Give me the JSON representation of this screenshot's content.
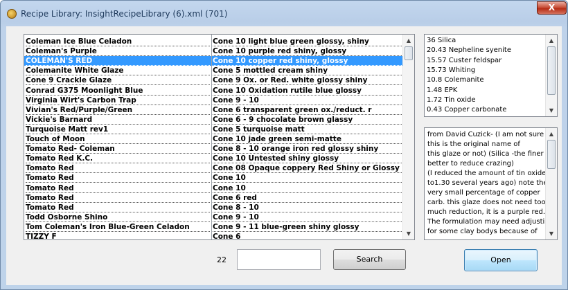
{
  "window": {
    "title": "Recipe Library: InsightRecipeLibrary (6).xml (701)",
    "close_label": "X"
  },
  "recipes": [
    {
      "name": "Coleman Ice Blue Celadon",
      "desc": "Cone 10  light blue green  glossy, shiny"
    },
    {
      "name": "Coleman's Purple",
      "desc": "Cone 10  purple red  shiny, glossy"
    },
    {
      "name": "COLEMAN'S RED",
      "desc": "Cone 10  copper red  shiny, glossy"
    },
    {
      "name": "Colemanite White Glaze",
      "desc": "Cone 5  mottled cream  shiny"
    },
    {
      "name": "Cone 9 Crackle Glaze",
      "desc": "Cone 9 Ox. or Red. white  glossy shiny"
    },
    {
      "name": "Conrad G375 Moonlight Blue",
      "desc": "Cone 10 Oxidation rutile blue  glossy"
    },
    {
      "name": "Virginia Wirt's Carbon Trap",
      "desc": "Cone 9 - 10"
    },
    {
      "name": "Vivian's Red/Purple/Green",
      "desc": "Cone 6  transparent green ox./reduct. r"
    },
    {
      "name": "Vickie's Barnard",
      "desc": "Cone 6 - 9  chocolate brown  glassy"
    },
    {
      "name": "Turquoise Matt rev1",
      "desc": "Cone 5  turquoise  matt"
    },
    {
      "name": "Touch of Moon",
      "desc": "Cone 10  jade green  semi-matte"
    },
    {
      "name": "Tomato Red- Coleman",
      "desc": "Cone 8 - 10  orange iron red  glossy shiny"
    },
    {
      "name": "Tomato Red K.C.",
      "desc": "Cone 10  Untested  shiny glossy"
    },
    {
      "name": "Tomato Red",
      "desc": "Cone 08  Opaque coppery Red  Shiny or Glossy"
    },
    {
      "name": "Tomato Red",
      "desc": "Cone 10"
    },
    {
      "name": "Tomato Red",
      "desc": "Cone 10"
    },
    {
      "name": "Tomato Red",
      "desc": "Cone 6  red"
    },
    {
      "name": "Tomato Red",
      "desc": "Cone 8 - 10"
    },
    {
      "name": "Todd Osborne Shino",
      "desc": "Cone 9 - 10"
    },
    {
      "name": "Tom Coleman's Iron Blue-Green Celadon",
      "desc": "Cone 9 - 11  blue-green  shiny glossy"
    },
    {
      "name": "TIZZY F",
      "desc": "Cone 6"
    }
  ],
  "selected_index": 2,
  "ingredients": [
    "36 Silica",
    "20.43 Nepheline syenite",
    "15.57 Custer feldspar",
    "15.73 Whiting",
    "10.8 Colemanite",
    "1.48 EPK",
    "1.72 Tin oxide",
    "0.43 Copper carbonate"
  ],
  "notes": [
    "from David Cuzick- (I am not sure if",
    "this is the original name of",
    " this glaze or not) (Silica -the finer the",
    "better to reduce crazing)",
    " (I reduced the amount of tin oxide",
    "to1.30 several years ago) note the",
    " very small percentage of copper",
    "carb. this glaze does not need too",
    " much reduction, it is a purple red.",
    "The formulation may need adjusting",
    "for some clay bodys because of"
  ],
  "footer": {
    "count": "22",
    "search_value": "",
    "search_label": "Search",
    "open_label": "Open"
  },
  "colors": {
    "selection": "#3399ff",
    "title_text": "#1e395b"
  }
}
